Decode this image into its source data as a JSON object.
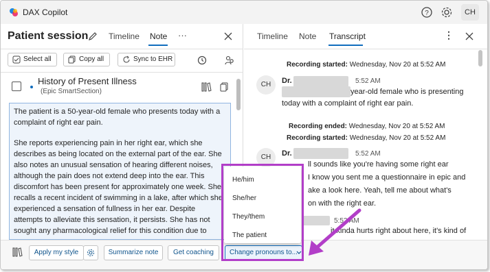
{
  "app": {
    "title": "DAX Copilot",
    "avatar_initials": "CH"
  },
  "left": {
    "session_title": "Patient session",
    "tabs": [
      {
        "label": "Timeline"
      },
      {
        "label": "Note"
      }
    ],
    "more_label": "···",
    "toolbar": {
      "select_all": "Select all",
      "copy_all": "Copy all",
      "sync": "Sync to EHR"
    },
    "section": {
      "title": "History of Present Illness",
      "subtitle": "(Epic SmartSection)"
    },
    "note_paragraphs": [
      "The patient is a 50-year-old female who presents today with a complaint of right ear pain.",
      "She reports experiencing pain in her right ear, which she describes as being located on the external part of the ear. She also notes an unusual sensation of hearing different noises, although the pain does not extend deep into the ear. This discomfort has been present for approximately one week. She recalls a recent incident of swimming in a lake, after which she experienced a sensation of fullness in her ear. Despite attempts to alleviate this sensation, it persists. She has not sought any pharmacological relief for this condition due to"
    ]
  },
  "bottom": {
    "apply_style": "Apply my style",
    "summarize": "Summarize note",
    "coaching": "Get coaching",
    "change_pronouns": "Change pronouns to...",
    "pronoun_options": [
      "He/him",
      "She/her",
      "They/them",
      "The patient"
    ]
  },
  "right": {
    "tabs": [
      {
        "label": "Timeline"
      },
      {
        "label": "Note"
      },
      {
        "label": "Transcript"
      }
    ],
    "entries": [
      {
        "kind": "meta",
        "label": "Recording started:",
        "value": "Wednesday, Nov 20 at 5:52 AM"
      },
      {
        "kind": "speech",
        "initials": "CH",
        "speaker": "Dr.",
        "time": "5:52 AM",
        "line1": "year-old female who is presenting",
        "line2": "today with a complaint of right ear pain."
      },
      {
        "kind": "meta",
        "label": "Recording ended:",
        "value": "Wednesday, Nov 20 at 5:52 AM"
      },
      {
        "kind": "meta",
        "label": "Recording started:",
        "value": "Wednesday, Nov 20 at 5:52 AM"
      },
      {
        "kind": "speech",
        "initials": "CH",
        "speaker": "Dr.",
        "time": "5:52 AM",
        "line1": "ll sounds like you're having some right ear",
        "line2": "I know you sent me a questionnaire in epic and",
        "line3": "ake a look here. Yeah, tell me about what's",
        "line4": "on with the right ear."
      },
      {
        "kind": "speech_partial",
        "time": "5:52 AM",
        "line1": "it kinda hurts right about here, it's kind of"
      }
    ]
  },
  "colors": {
    "accent": "#0f6cbd",
    "highlight": "#b23ec8"
  }
}
